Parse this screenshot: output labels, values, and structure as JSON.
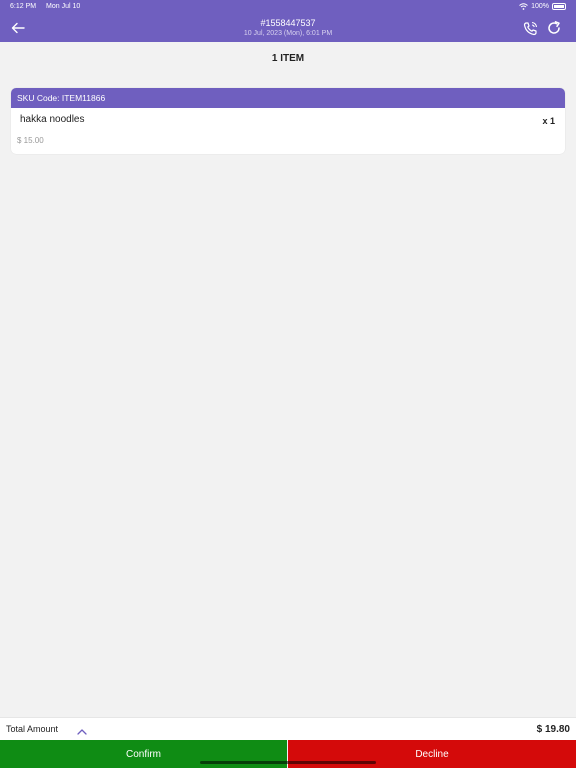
{
  "status_bar": {
    "time": "6:12 PM",
    "date": "Mon Jul 10",
    "battery": "100%"
  },
  "header": {
    "order_id": "#1558447537",
    "order_datetime": "10 Jul, 2023 (Mon),  6:01 PM",
    "back_icon": "arrow-left-icon",
    "call_icon": "phone-icon",
    "refresh_icon": "refresh-icon"
  },
  "items_count": "1 ITEM",
  "items": [
    {
      "sku_label": "SKU Code: ITEM11866",
      "name": "hakka noodles",
      "quantity": "x 1",
      "price": "$ 15.00"
    }
  ],
  "footer": {
    "total_label": "Total Amount",
    "total_value": "$ 19.80",
    "confirm_label": "Confirm",
    "decline_label": "Decline"
  },
  "colors": {
    "accent": "#6f5fbf",
    "confirm": "#0f8c14",
    "decline": "#d40a0a",
    "background": "#f2f2f2"
  }
}
